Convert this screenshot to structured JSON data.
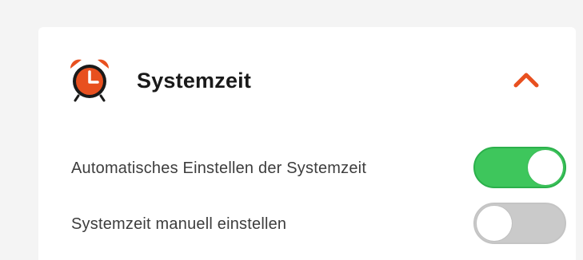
{
  "section": {
    "title": "Systemzeit",
    "icon": "alarm-clock-icon",
    "expanded": true,
    "collapse_icon": "chevron-up-icon"
  },
  "settings": [
    {
      "label": "Automatisches Einstellen der Systemzeit",
      "enabled": true
    },
    {
      "label": "Systemzeit manuell einstellen",
      "enabled": false
    }
  ],
  "colors": {
    "accent": "#e8501f",
    "toggle_on": "#3ec65c",
    "toggle_off": "#cacaca",
    "title_text": "#1a1a1a",
    "label_text": "#3d3d3d",
    "background": "#f4f4f4",
    "card": "#ffffff"
  }
}
